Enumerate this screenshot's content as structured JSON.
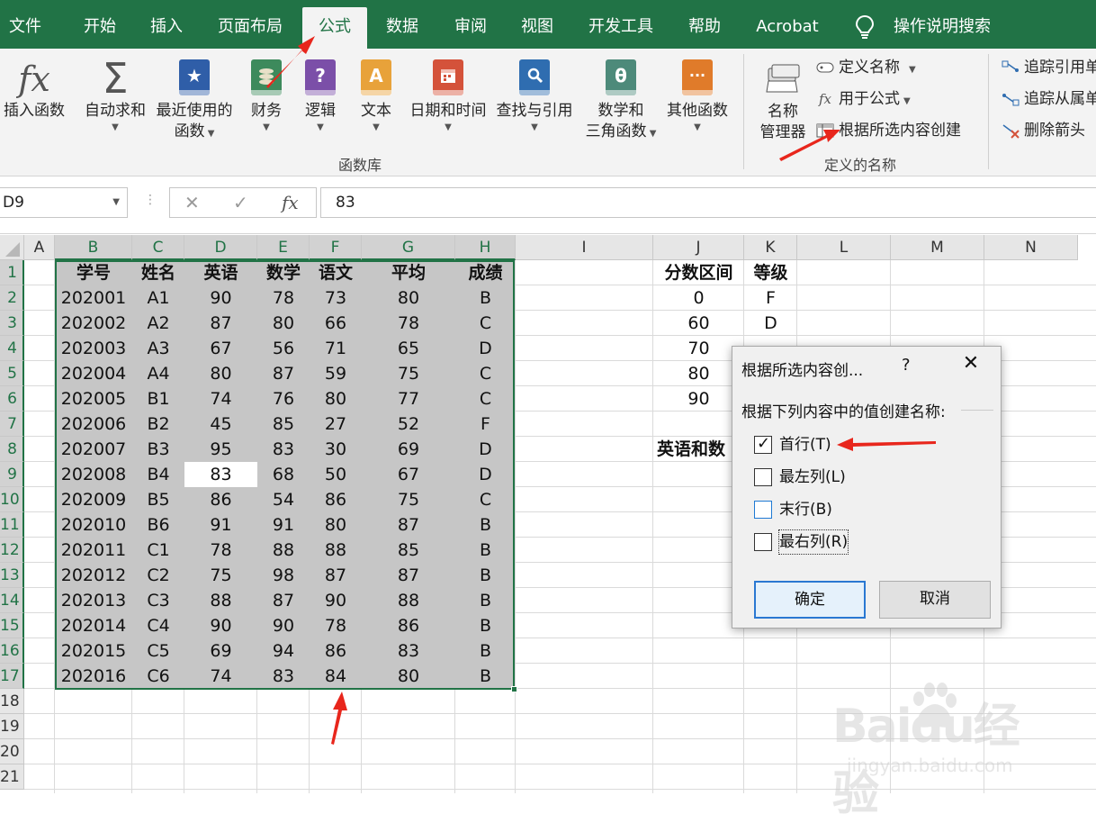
{
  "tabs": [
    "文件",
    "开始",
    "插入",
    "页面布局",
    "公式",
    "数据",
    "审阅",
    "视图",
    "开发工具",
    "帮助",
    "Acrobat"
  ],
  "tell_me": "操作说明搜索",
  "ribbon": {
    "insert_function": {
      "icon": "fx",
      "label": "插入函数"
    },
    "autosum": {
      "icon": "Σ",
      "label": "自动求和"
    },
    "recent": {
      "icon": "★",
      "label1": "最近使用的",
      "label2": "函数"
    },
    "financial": {
      "label": "财务"
    },
    "logical": {
      "icon": "?",
      "label": "逻辑"
    },
    "text": {
      "icon": "A",
      "label": "文本"
    },
    "datetime": {
      "label": "日期和时间"
    },
    "lookup": {
      "label": "查找与引用"
    },
    "math": {
      "icon": "θ",
      "label1": "数学和",
      "label2": "三角函数"
    },
    "more": {
      "icon": "···",
      "label": "其他函数"
    },
    "group_function_library": "函数库",
    "name_manager": {
      "label1": "名称",
      "label2": "管理器"
    },
    "define_name": "定义名称",
    "use_in_formula": "用于公式",
    "create_from_selection": "根据所选内容创建",
    "group_defined_names": "定义的名称",
    "trace_precedents": "追踪引用单",
    "trace_dependents": "追踪从属单",
    "remove_arrows": "删除箭头"
  },
  "formula_bar": {
    "name_box": "D9",
    "fx": "fx",
    "value": "83"
  },
  "columns": [
    "A",
    "B",
    "C",
    "D",
    "E",
    "F",
    "G",
    "H",
    "I",
    "J",
    "K",
    "L",
    "M",
    "N"
  ],
  "rows": [
    "1",
    "2",
    "3",
    "4",
    "5",
    "6",
    "7",
    "8",
    "9",
    "10",
    "11",
    "12",
    "13",
    "14",
    "15",
    "16",
    "17",
    "18",
    "19",
    "20",
    "21"
  ],
  "table": {
    "headers": [
      "学号",
      "姓名",
      "英语",
      "数学",
      "语文",
      "平均",
      "成绩"
    ],
    "rows": [
      [
        "202001",
        "A1",
        "90",
        "78",
        "73",
        "80",
        "B"
      ],
      [
        "202002",
        "A2",
        "87",
        "80",
        "66",
        "78",
        "C"
      ],
      [
        "202003",
        "A3",
        "67",
        "56",
        "71",
        "65",
        "D"
      ],
      [
        "202004",
        "A4",
        "80",
        "87",
        "59",
        "75",
        "C"
      ],
      [
        "202005",
        "B1",
        "74",
        "76",
        "80",
        "77",
        "C"
      ],
      [
        "202006",
        "B2",
        "45",
        "85",
        "27",
        "52",
        "F"
      ],
      [
        "202007",
        "B3",
        "95",
        "83",
        "30",
        "69",
        "D"
      ],
      [
        "202008",
        "B4",
        "83",
        "68",
        "50",
        "67",
        "D"
      ],
      [
        "202009",
        "B5",
        "86",
        "54",
        "86",
        "75",
        "C"
      ],
      [
        "202010",
        "B6",
        "91",
        "91",
        "80",
        "87",
        "B"
      ],
      [
        "202011",
        "C1",
        "78",
        "88",
        "88",
        "85",
        "B"
      ],
      [
        "202012",
        "C2",
        "75",
        "98",
        "87",
        "87",
        "B"
      ],
      [
        "202013",
        "C3",
        "88",
        "87",
        "90",
        "88",
        "B"
      ],
      [
        "202014",
        "C4",
        "90",
        "90",
        "78",
        "86",
        "B"
      ],
      [
        "202015",
        "C5",
        "69",
        "94",
        "86",
        "83",
        "B"
      ],
      [
        "202016",
        "C6",
        "74",
        "83",
        "84",
        "80",
        "B"
      ]
    ]
  },
  "grade_table": {
    "headers": [
      "分数区间",
      "等级"
    ],
    "rows": [
      [
        "0",
        "F"
      ],
      [
        "60",
        "D"
      ],
      [
        "70",
        ""
      ],
      [
        "80",
        ""
      ],
      [
        "90",
        ""
      ]
    ]
  },
  "j9_text": "英语和数",
  "dialog": {
    "title": "根据所选内容创...",
    "help": "?",
    "prompt": "根据下列内容中的值创建名称:",
    "options": [
      {
        "label": "首行(T)",
        "checked": true
      },
      {
        "label": "最左列(L)",
        "checked": false
      },
      {
        "label": "末行(B)",
        "checked": false
      },
      {
        "label": "最右列(R)",
        "checked": false
      }
    ],
    "ok": "确定",
    "cancel": "取消"
  },
  "watermark": {
    "text": "Baidu经验",
    "url": "jingyan.baidu.com"
  },
  "colors": {
    "excel_green": "#217346",
    "ribbon_bg": "#f3f3f3",
    "arrow_red": "#e8261c",
    "selection_fill": "#c6c6c6"
  }
}
